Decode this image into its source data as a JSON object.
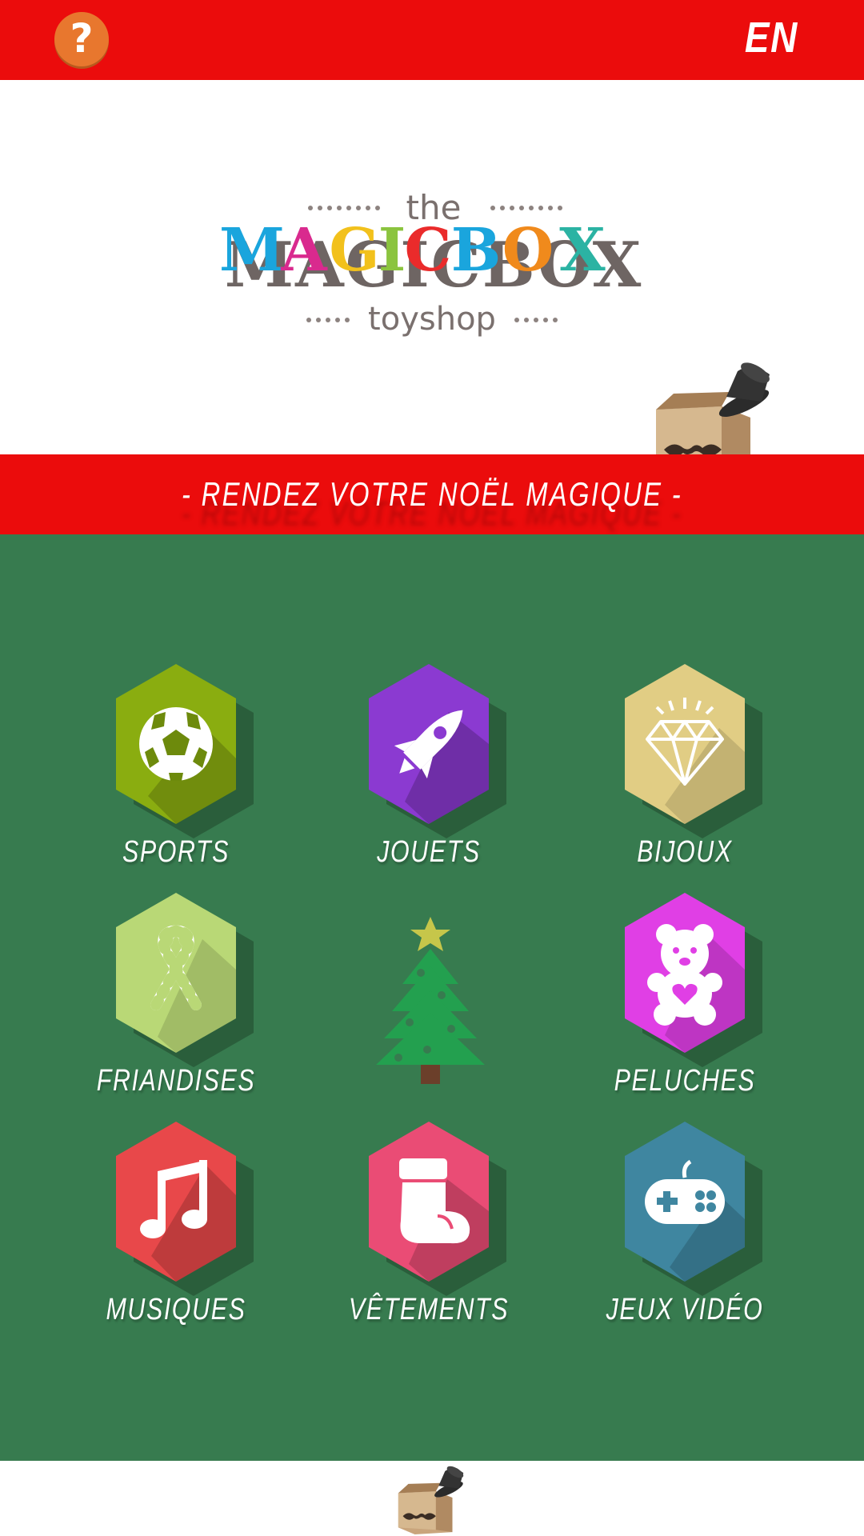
{
  "header": {
    "help_symbol": "?",
    "language": "EN"
  },
  "logo": {
    "line1": "the",
    "line2": "MAGICBOX",
    "line3": "toyshop",
    "letter_colors": [
      "#1aa5dd",
      "#d92a8e",
      "#f2c11c",
      "#8bc43f",
      "#ea2b2b",
      "#1aa5dd",
      "#f08a1c",
      "#2bb3a3"
    ],
    "shadow_color": "#6e6563"
  },
  "banner": {
    "text": "- RENDEZ VOTRE NOËL MAGIQUE -"
  },
  "categories": [
    {
      "label": "SPORTS",
      "color": "#8aad10",
      "icon": "soccer-ball-icon"
    },
    {
      "label": "JOUETS",
      "color": "#8b3ad1",
      "icon": "rocket-icon"
    },
    {
      "label": "BIJOUX",
      "color": "#e1cd84",
      "icon": "diamond-icon"
    },
    {
      "label": "FRIANDISES",
      "color": "#b9d876",
      "icon": "candy-cane-icon"
    },
    {
      "label": "PELUCHES",
      "color": "#e03fe5",
      "icon": "teddy-bear-icon"
    },
    {
      "label": "MUSIQUES",
      "color": "#e8484a",
      "icon": "music-note-icon"
    },
    {
      "label": "VÊTEMENTS",
      "color": "#ea4c75",
      "icon": "stocking-icon"
    },
    {
      "label": "JEUX VIDÉO",
      "color": "#3f86a0",
      "icon": "gamepad-icon"
    }
  ],
  "colors": {
    "red": "#eb0c0c",
    "green": "#377b4f",
    "help_orange": "#e8772e"
  }
}
